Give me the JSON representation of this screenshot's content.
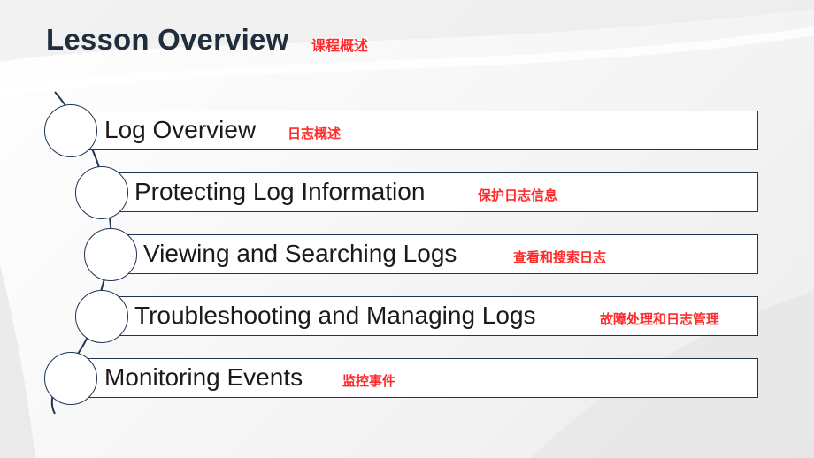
{
  "title": "Lesson Overview",
  "title_cn": "课程概述",
  "items": [
    {
      "label": "Log Overview",
      "cn": "日志概述"
    },
    {
      "label": "Protecting Log Information",
      "cn": "保护日志信息"
    },
    {
      "label": "Viewing and Searching Logs",
      "cn": "查看和搜索日志"
    },
    {
      "label": "Troubleshooting and Managing Logs",
      "cn": "故障处理和日志管理"
    },
    {
      "label": "Monitoring Events",
      "cn": "监控事件"
    }
  ],
  "colors": {
    "title": "#1f2d3d",
    "outline": "#1f3553",
    "cn_tag": "#ff2b2b"
  }
}
